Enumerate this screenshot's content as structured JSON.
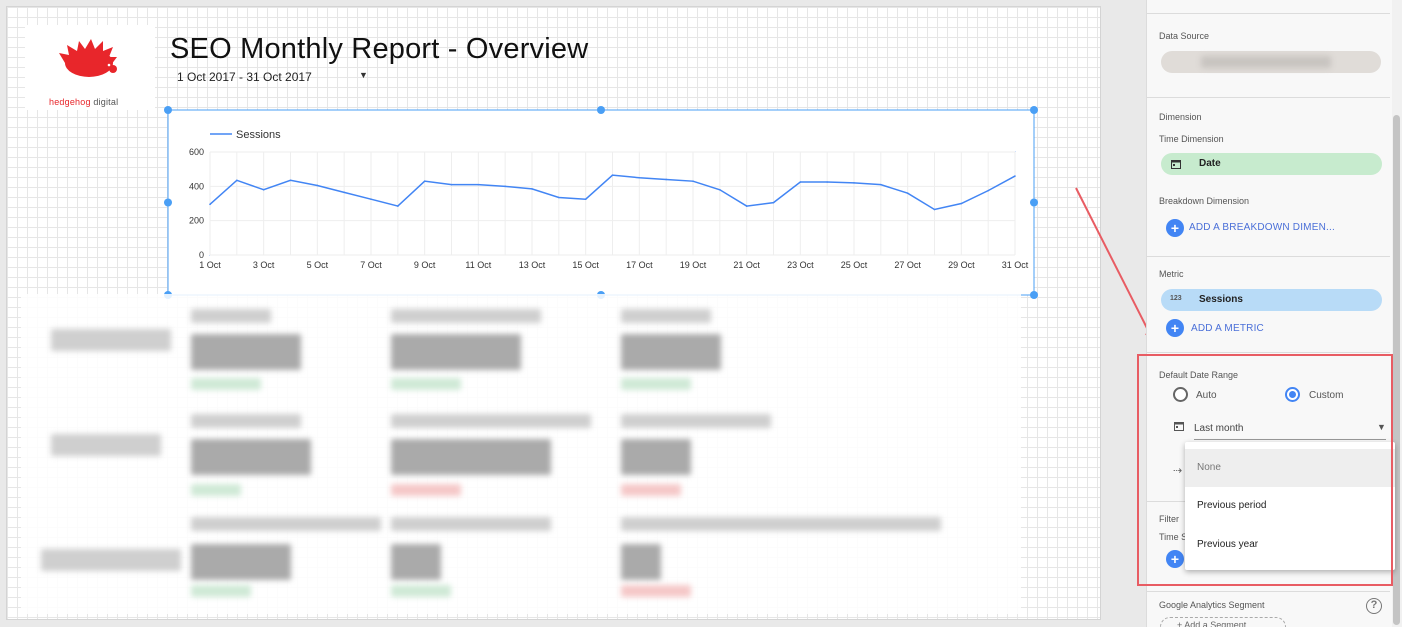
{
  "report": {
    "title": "SEO Monthly Report - Overview",
    "date_range": "1 Oct 2017 - 31 Oct 2017",
    "logo": {
      "brand": "hedgehog",
      "suffix": " digital"
    }
  },
  "chart_data": {
    "type": "line",
    "legend": "Sessions",
    "x": [
      "1 Oct",
      "2 Oct",
      "3 Oct",
      "4 Oct",
      "5 Oct",
      "6 Oct",
      "7 Oct",
      "8 Oct",
      "9 Oct",
      "10 Oct",
      "11 Oct",
      "12 Oct",
      "13 Oct",
      "14 Oct",
      "15 Oct",
      "16 Oct",
      "17 Oct",
      "18 Oct",
      "19 Oct",
      "20 Oct",
      "21 Oct",
      "22 Oct",
      "23 Oct",
      "24 Oct",
      "25 Oct",
      "26 Oct",
      "27 Oct",
      "28 Oct",
      "29 Oct",
      "30 Oct",
      "31 Oct"
    ],
    "x_tick_labels": [
      "1 Oct",
      "3 Oct",
      "5 Oct",
      "7 Oct",
      "9 Oct",
      "11 Oct",
      "13 Oct",
      "15 Oct",
      "17 Oct",
      "19 Oct",
      "21 Oct",
      "23 Oct",
      "25 Oct",
      "27 Oct",
      "29 Oct",
      "31 Oct"
    ],
    "series": [
      {
        "name": "Sessions",
        "values": [
          295,
          435,
          380,
          435,
          405,
          365,
          325,
          285,
          430,
          410,
          410,
          400,
          385,
          335,
          325,
          465,
          450,
          440,
          430,
          380,
          285,
          305,
          425,
          425,
          420,
          410,
          360,
          265,
          300,
          375,
          460
        ]
      }
    ],
    "ylim": [
      0,
      600
    ],
    "y_ticks": [
      0,
      200,
      400,
      600
    ],
    "line_color": "#4285f4"
  },
  "panel": {
    "data_source_label": "Data Source",
    "dimension_header": "Dimension",
    "time_dimension_label": "Time Dimension",
    "time_dimension_value": "Date",
    "breakdown_label": "Breakdown Dimension",
    "add_breakdown": "ADD A BREAKDOWN DIMEN...",
    "metric_header": "Metric",
    "metric_badge": "123",
    "metric_value": "Sessions",
    "add_metric": "ADD A METRIC",
    "default_date_range_label": "Default Date Range",
    "radio_auto": "Auto",
    "radio_custom": "Custom",
    "date_select_value": "Last month",
    "comparison_options": [
      "None",
      "Previous period",
      "Previous year"
    ],
    "filter_label": "Filter",
    "time_filter_label": "Time S",
    "ga_segment_label": "Google Analytics Segment",
    "add_segment": "+ Add a Segment"
  },
  "colors": {
    "accent": "#4285f4",
    "date_chip": "#c7ebce",
    "metric_chip": "#b8dbf7",
    "annotation": "#e85c63"
  }
}
